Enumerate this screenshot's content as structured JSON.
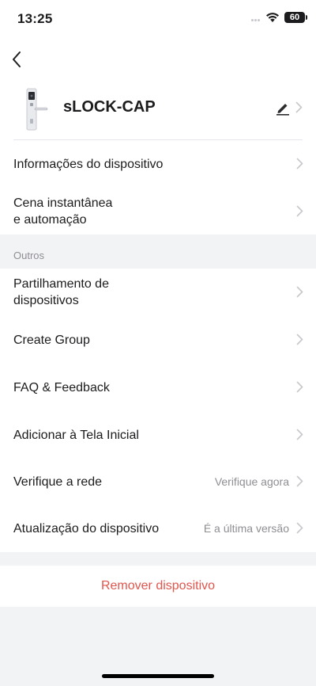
{
  "status_bar": {
    "time": "13:25",
    "battery": "60"
  },
  "device": {
    "name": "sLOCK-CAP"
  },
  "top_rows": [
    {
      "label": "Informações do dispositivo"
    },
    {
      "label_line1": "Cena instantânea",
      "label_line2": "e automação"
    }
  ],
  "section": {
    "title": "Outros"
  },
  "other_rows": [
    {
      "label_line1": "Partilhamento de",
      "label_line2": "dispositivos"
    },
    {
      "label": "Create Group"
    },
    {
      "label": "FAQ & Feedback"
    },
    {
      "label": "Adicionar à Tela Inicial"
    },
    {
      "label": "Verifique a rede",
      "value": "Verifique agora"
    },
    {
      "label": "Atualização do dispositivo",
      "value": "É a última versão"
    }
  ],
  "remove": {
    "label": "Remover dispositivo"
  },
  "colors": {
    "danger": "#e0554d",
    "secondary_text": "#8e8e93",
    "background": "#f2f3f5"
  },
  "icons": [
    "back-chevron-icon",
    "edit-pencil-icon",
    "chevron-right-icon",
    "wifi-icon",
    "battery-icon",
    "smart-lock-image"
  ]
}
